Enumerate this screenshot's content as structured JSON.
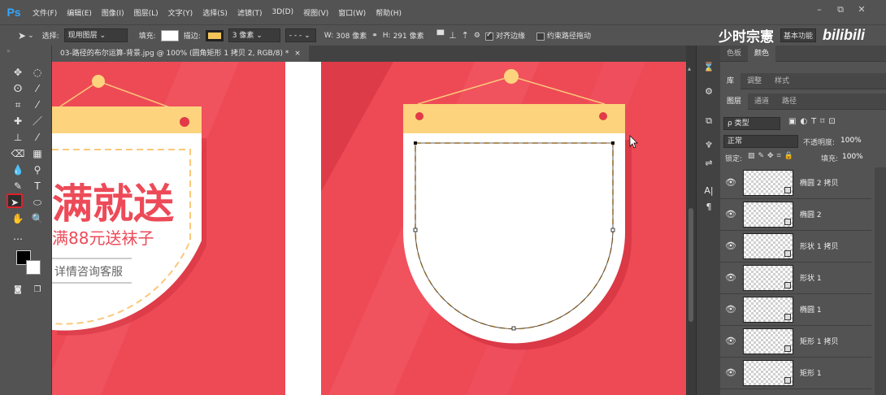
{
  "app": {
    "logo": "Ps"
  },
  "menu": [
    "文件(F)",
    "编辑(E)",
    "图像(I)",
    "图层(L)",
    "文字(Y)",
    "选择(S)",
    "滤镜(T)",
    "3D(D)",
    "视图(V)",
    "窗口(W)",
    "帮助(H)"
  ],
  "window_controls": [
    "–",
    "⧉",
    "✕"
  ],
  "options": {
    "select_label": "选择:",
    "select_value": "现用图层",
    "fill_label": "填充:",
    "stroke_label": "描边:",
    "stroke_size": "3 像素",
    "w_label": "W:",
    "w_value": "308 像素",
    "h_label": "H:",
    "h_value": "291 像素",
    "align_edges": "对齐边缘",
    "constrain_path": "约束路径拖动"
  },
  "watermark": {
    "channel": "少时宗憲",
    "site": "bilibili",
    "preset": "基本功能"
  },
  "document": {
    "tab_title": "03-路径的布尔运算-背景.jpg @ 100% (圆角矩形 1 拷贝 2, RGB/8) *",
    "close": "×"
  },
  "canvas_text": {
    "big": "满就送",
    "promo": "满88元送袜子",
    "consult": "详情咨询客服"
  },
  "panels": {
    "top_tabs": [
      {
        "label": "色板",
        "active": false
      },
      {
        "label": "颜色",
        "active": true
      }
    ],
    "mid_tabs": [
      {
        "label": "库",
        "active": true
      },
      {
        "label": "调整",
        "active": false
      },
      {
        "label": "样式",
        "active": false
      }
    ],
    "layer_tabs": [
      {
        "label": "图层",
        "active": true
      },
      {
        "label": "通道",
        "active": false
      },
      {
        "label": "路径",
        "active": false
      }
    ],
    "filter_kind": "ρ 类型",
    "blend_mode": "正常",
    "opacity_label": "不透明度:",
    "opacity_value": "100%",
    "lock_label": "锁定:",
    "fill_label": "填充:",
    "fill_value": "100%",
    "layers": [
      {
        "name": "椭圆 2 拷贝"
      },
      {
        "name": "椭圆 2"
      },
      {
        "name": "形状 1 拷贝"
      },
      {
        "name": "形状 1"
      },
      {
        "name": "椭圆 1"
      },
      {
        "name": "矩形 1 拷贝"
      },
      {
        "name": "矩形 1"
      }
    ]
  },
  "colors": {
    "canvas_red": "#ee4a56",
    "dark_red": "#d2323f",
    "banner_yellow": "#fdd37e",
    "dot_red": "#e23a46",
    "dash_orange": "#fbc87a",
    "pink_text": "#ed4a58"
  }
}
